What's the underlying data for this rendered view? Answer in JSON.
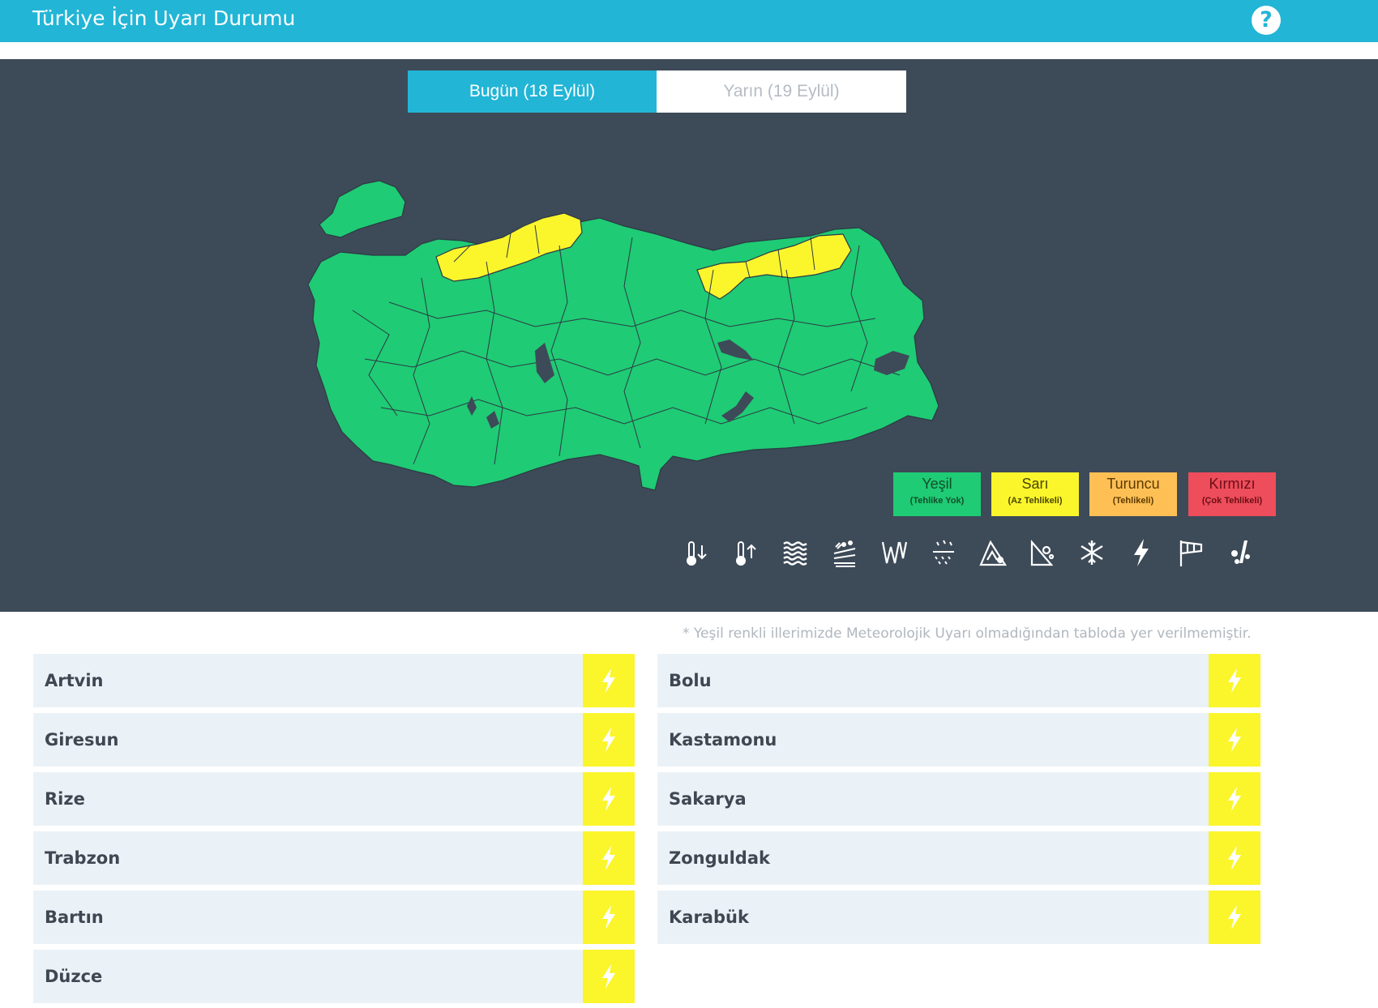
{
  "header": {
    "title": "Türkiye İçin Uyarı Durumu",
    "help_icon": "help-circle-icon"
  },
  "tabs": [
    {
      "label": "Bugün (18 Eylül)",
      "active": true
    },
    {
      "label": "Yarın (19 Eylül)",
      "active": false
    }
  ],
  "map": {
    "default_level": "Yeşil",
    "yellow_regions": [
      "Batı Karadeniz",
      "Doğu Karadeniz"
    ]
  },
  "legend": [
    {
      "name": "Yeşil",
      "desc": "(Tehlike Yok)",
      "color": "#1fcb74"
    },
    {
      "name": "Sarı",
      "desc": "(Az Tehlikeli)",
      "color": "#fbf52c"
    },
    {
      "name": "Turuncu",
      "desc": "(Tehlikeli)",
      "color": "#fec055"
    },
    {
      "name": "Kırmızı",
      "desc": "(Çok Tehlikeli)",
      "color": "#ee4d5b"
    }
  ],
  "hazard_icons": [
    "cold-thermometer-icon",
    "hot-thermometer-icon",
    "fog-waves-icon",
    "dust-storm-icon",
    "wind-icon",
    "rain-snow-icon",
    "avalanche-icon",
    "landslide-icon",
    "snowflake-icon",
    "lightning-icon",
    "windsock-icon",
    "hail-icon"
  ],
  "note": "* Yeşil renkli illerimizde Meteorolojik Uyarı olmadığından tabloda yer verilmemiştir.",
  "provinces_left": [
    {
      "name": "Artvin",
      "level_color": "#fbf52c",
      "icon": "lightning-icon"
    },
    {
      "name": "Giresun",
      "level_color": "#fbf52c",
      "icon": "lightning-icon"
    },
    {
      "name": "Rize",
      "level_color": "#fbf52c",
      "icon": "lightning-icon"
    },
    {
      "name": "Trabzon",
      "level_color": "#fbf52c",
      "icon": "lightning-icon"
    },
    {
      "name": "Bartın",
      "level_color": "#fbf52c",
      "icon": "lightning-icon"
    },
    {
      "name": "Düzce",
      "level_color": "#fbf52c",
      "icon": "lightning-icon"
    }
  ],
  "provinces_right": [
    {
      "name": "Bolu",
      "level_color": "#fbf52c",
      "icon": "lightning-icon"
    },
    {
      "name": "Kastamonu",
      "level_color": "#fbf52c",
      "icon": "lightning-icon"
    },
    {
      "name": "Sakarya",
      "level_color": "#fbf52c",
      "icon": "lightning-icon"
    },
    {
      "name": "Zonguldak",
      "level_color": "#fbf52c",
      "icon": "lightning-icon"
    },
    {
      "name": "Karabük",
      "level_color": "#fbf52c",
      "icon": "lightning-icon"
    }
  ]
}
